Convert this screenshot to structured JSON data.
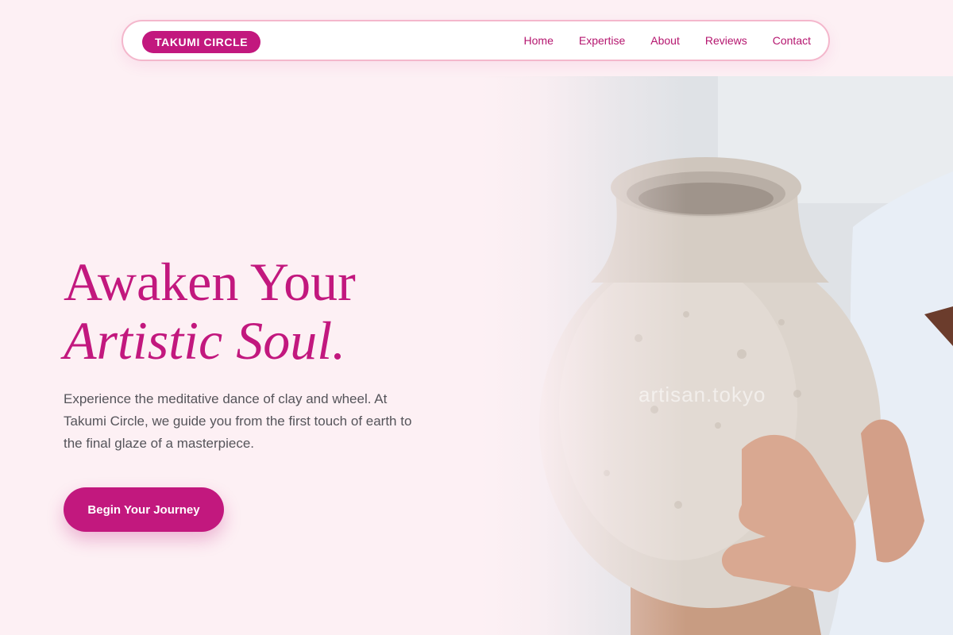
{
  "brand": {
    "name": "TAKUMI CIRCLE"
  },
  "nav": {
    "links": [
      {
        "label": "Home"
      },
      {
        "label": "Expertise"
      },
      {
        "label": "About"
      },
      {
        "label": "Reviews"
      },
      {
        "label": "Contact"
      }
    ]
  },
  "hero": {
    "title_line1": "Awaken Your",
    "title_line2": "Artistic Soul.",
    "description": "Experience the meditative dance of clay and wheel. At Takumi Circle, we guide you from the first touch of earth to the final glaze of a masterpiece.",
    "cta_label": "Begin Your Journey",
    "image_watermark": "artisan.tokyo"
  },
  "colors": {
    "accent": "#c2187e",
    "page_background": "#fdf0f4",
    "nav_border": "#f4b7cc",
    "body_text": "#55545a"
  }
}
